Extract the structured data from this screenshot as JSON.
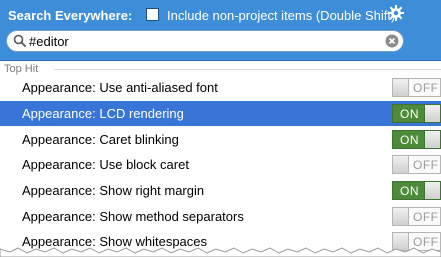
{
  "header": {
    "title": "Search Everywhere:",
    "include_label": "Include non-project items (Double Shift)",
    "include_checked": false,
    "settings_icon": "gear-icon"
  },
  "search": {
    "value": "#editor",
    "search_icon": "search-icon",
    "clear_icon": "clear-icon"
  },
  "results": {
    "group_title": "Top Hit",
    "items": [
      {
        "label": "Appearance: Use anti-aliased font",
        "state": "OFF",
        "selected": false
      },
      {
        "label": "Appearance: LCD rendering",
        "state": "ON",
        "selected": true
      },
      {
        "label": "Appearance: Caret blinking",
        "state": "ON",
        "selected": false
      },
      {
        "label": "Appearance: Use block caret",
        "state": "OFF",
        "selected": false
      },
      {
        "label": "Appearance: Show right margin",
        "state": "ON",
        "selected": false
      },
      {
        "label": "Appearance: Show method separators",
        "state": "OFF",
        "selected": false
      },
      {
        "label": "Appearance: Show whitespaces",
        "state": "OFF",
        "selected": false
      }
    ]
  },
  "colors": {
    "header_bg": "#3d8dd9",
    "selection_bg": "#3875d7",
    "toggle_on": "#4d8a3a"
  }
}
